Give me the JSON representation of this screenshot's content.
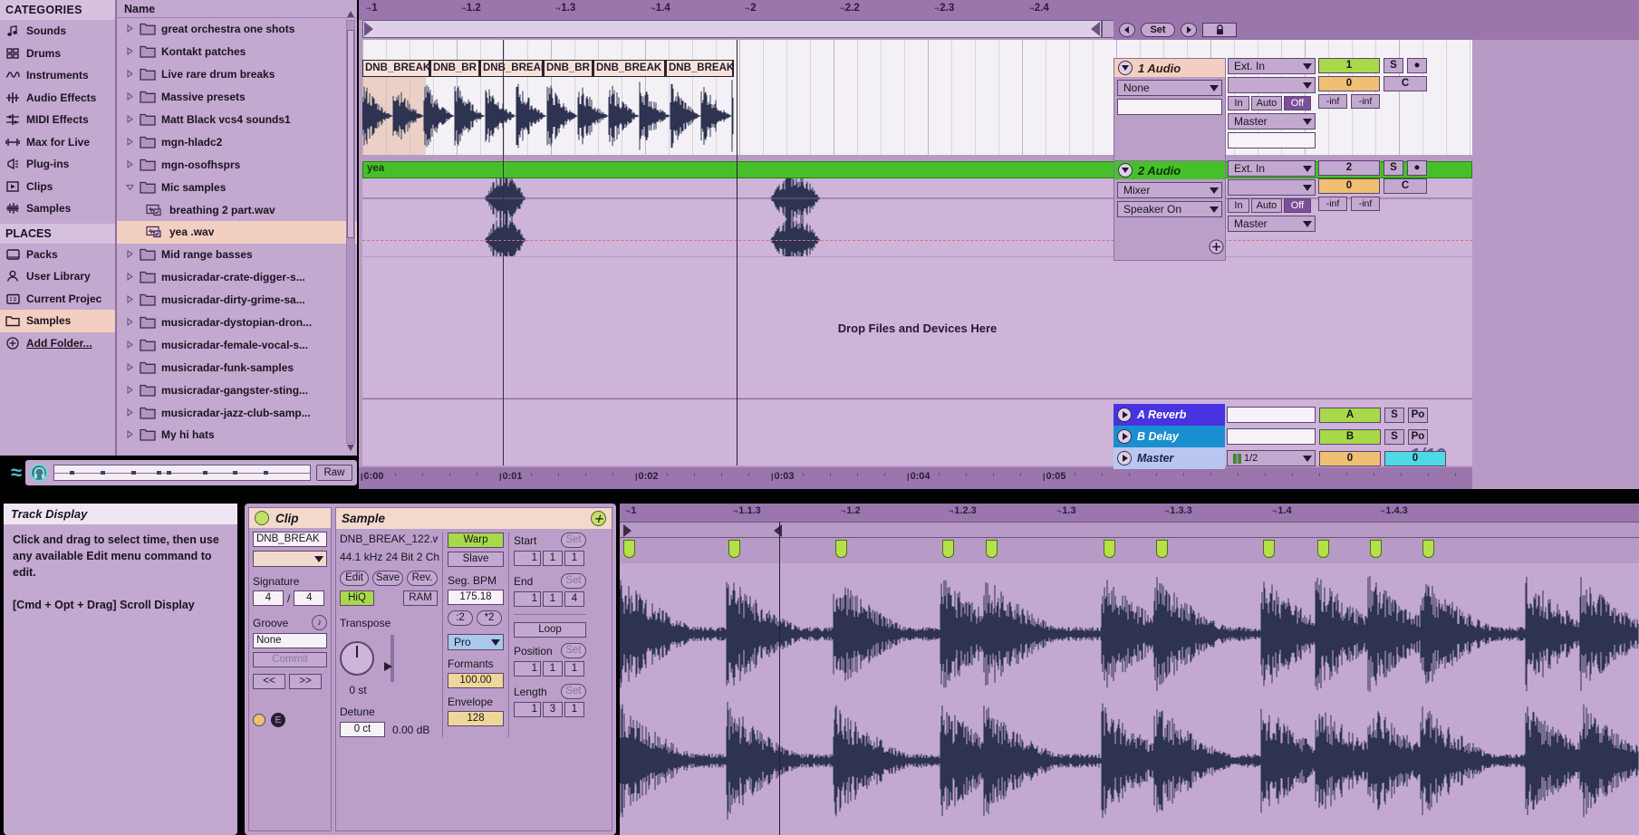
{
  "browser": {
    "categories_header": "CATEGORIES",
    "categories": [
      {
        "label": "Sounds",
        "icon": "note-icon",
        "selected": false
      },
      {
        "label": "Drums",
        "icon": "drums-grid-icon",
        "selected": false
      },
      {
        "label": "Instruments",
        "icon": "waveform-icon",
        "selected": false
      },
      {
        "label": "Audio Effects",
        "icon": "audio-effects-icon",
        "selected": false
      },
      {
        "label": "MIDI Effects",
        "icon": "midi-effects-icon",
        "selected": false
      },
      {
        "label": "Max for Live",
        "icon": "max-for-live-icon",
        "selected": false
      },
      {
        "label": "Plug-ins",
        "icon": "plugin-icon",
        "selected": false
      },
      {
        "label": "Clips",
        "icon": "clip-icon",
        "selected": false
      },
      {
        "label": "Samples",
        "icon": "samples-icon",
        "selected": false
      }
    ],
    "places_header": "PLACES",
    "places": [
      {
        "label": "Packs",
        "icon": "pack-icon",
        "selected": false
      },
      {
        "label": "User Library",
        "icon": "user-icon",
        "selected": false
      },
      {
        "label": "Current Projec",
        "icon": "project-icon",
        "selected": false
      },
      {
        "label": "Samples",
        "icon": "folder-icon",
        "selected": true
      },
      {
        "label": "Add Folder...",
        "icon": "plus-circle-icon",
        "selected": false
      }
    ],
    "files_header": "Name",
    "files": [
      {
        "label": "great orchestra one shots",
        "type": "folder",
        "expanded": false,
        "selected": false
      },
      {
        "label": "Kontakt patches",
        "type": "folder",
        "expanded": false,
        "selected": false
      },
      {
        "label": "Live rare drum breaks",
        "type": "folder",
        "expanded": false,
        "selected": false
      },
      {
        "label": "Massive presets",
        "type": "folder",
        "expanded": false,
        "selected": false
      },
      {
        "label": "Matt Black vcs4 sounds1",
        "type": "folder",
        "expanded": false,
        "selected": false
      },
      {
        "label": "mgn-hladc2",
        "type": "folder",
        "expanded": false,
        "selected": false
      },
      {
        "label": "mgn-osofhsprs",
        "type": "folder",
        "expanded": false,
        "selected": false
      },
      {
        "label": "Mic samples",
        "type": "folder",
        "expanded": true,
        "selected": false
      },
      {
        "label": "breathing 2 part.wav",
        "type": "wav",
        "child": true,
        "selected": false
      },
      {
        "label": "yea .wav",
        "type": "wav",
        "child": true,
        "selected": true
      },
      {
        "label": "Mid range basses",
        "type": "folder",
        "expanded": false,
        "selected": false
      },
      {
        "label": "musicradar-crate-digger-s...",
        "type": "folder",
        "expanded": false,
        "selected": false
      },
      {
        "label": "musicradar-dirty-grime-sa...",
        "type": "folder",
        "expanded": false,
        "selected": false
      },
      {
        "label": "musicradar-dystopian-dron...",
        "type": "folder",
        "expanded": false,
        "selected": false
      },
      {
        "label": "musicradar-female-vocal-s...",
        "type": "folder",
        "expanded": false,
        "selected": false
      },
      {
        "label": "musicradar-funk-samples",
        "type": "folder",
        "expanded": false,
        "selected": false
      },
      {
        "label": "musicradar-gangster-sting...",
        "type": "folder",
        "expanded": false,
        "selected": false
      },
      {
        "label": "musicradar-jazz-club-samp...",
        "type": "folder",
        "expanded": false,
        "selected": false
      },
      {
        "label": "My hi hats",
        "type": "folder",
        "expanded": false,
        "selected": false
      }
    ],
    "overview": {
      "raw_label": "Raw"
    }
  },
  "arrangement": {
    "ruler_ticks": [
      "1",
      "1.2",
      "1.3",
      "1.4",
      "2",
      "2.2",
      "2.3",
      "2.4"
    ],
    "set_controls": {
      "set_label": "Set",
      "lock_icon": "lock-icon",
      "left_icon": "arrow-left-icon",
      "right_icon": "arrow-right-icon"
    },
    "clips": [
      "DNB_BREAK",
      "DNB_BR",
      "DNB_BREAK",
      "DNB_BR",
      "DNB_BREAK",
      "DNB_BREAK"
    ],
    "track2_clip_name": "yea",
    "drop_hint": "Drop Files and Devices Here",
    "quantization": "1/16",
    "time_ticks": [
      "0:00",
      "0:01",
      "0:02",
      "0:03",
      "0:04",
      "0:05"
    ]
  },
  "tracks": [
    {
      "name": "1 Audio",
      "device_slot": "None",
      "input_type": "Ext. In",
      "input_channel": "",
      "monitor": {
        "in": "In",
        "auto": "Auto",
        "off": "Off",
        "active": "Off"
      },
      "output": "Master",
      "output_sub": "",
      "number": "1",
      "solo": "S",
      "arm": "●",
      "volume": "0",
      "pan": "C",
      "meter_left": "-inf",
      "meter_right": "-inf"
    },
    {
      "name": "2 Audio",
      "device_slot": "Mixer",
      "device_slot2": "Speaker On",
      "input_type": "Ext. In",
      "input_channel": "",
      "monitor": {
        "in": "In",
        "auto": "Auto",
        "off": "Off",
        "active": "Off"
      },
      "output": "Master",
      "number": "2",
      "solo": "S",
      "arm": "●",
      "volume": "0",
      "pan": "C",
      "meter_left": "-inf",
      "meter_right": "-inf"
    }
  ],
  "returns": [
    {
      "name": "A Reverb",
      "letter": "A",
      "solo": "S",
      "extra": "Po"
    },
    {
      "name": "B Delay",
      "letter": "B",
      "solo": "S",
      "extra": "Po"
    }
  ],
  "master": {
    "name": "Master",
    "crossfade": "1/2",
    "volume": "0",
    "pan": "0"
  },
  "help_panel": {
    "title": "Track Display",
    "body1": "Click and drag to select time, then use any available Edit menu command to edit.",
    "body2": "[Cmd + Opt + Drag] Scroll Display"
  },
  "clip_panel": {
    "clip_header": "Clip",
    "clip_name": "DNB_BREAK",
    "color_swatch": "",
    "signature_label": "Signature",
    "signature_num": "4",
    "signature_den": "4",
    "groove_label": "Groove",
    "groove_value": "None",
    "commit_label": "Commit",
    "nudge_back": "<<",
    "nudge_fwd": ">>",
    "sample_header": "Sample",
    "sample_name": "DNB_BREAK_122.w",
    "sample_format": "44.1 kHz 24 Bit 2 Ch",
    "edit_label": "Edit",
    "save_label": "Save",
    "rev_label": "Rev.",
    "hiq_label": "HiQ",
    "ram_label": "RAM",
    "transpose_label": "Transpose",
    "transpose_value": "0 st",
    "detune_label": "Detune",
    "detune_value": "0 ct",
    "gain_value": "0.00 dB",
    "warp_label": "Warp",
    "warp_mode_sync": "Slave",
    "seg_bpm_label": "Seg. BPM",
    "seg_bpm_value": "175.18",
    "div2_label": ":2",
    "mul2_label": "*2",
    "warp_algo": "Pro",
    "formants_label": "Formants",
    "formants_value": "100.00",
    "envelope_label": "Envelope",
    "envelope_value": "128",
    "start_label": "Start",
    "start_set": "Set",
    "start_bars": "1",
    "start_beats": "1",
    "start_sixteenths": "1",
    "end_label": "End",
    "end_set": "Set",
    "end_bars": "1",
    "end_beats": "1",
    "end_sixteenths": "4",
    "loop_label": "Loop",
    "position_label": "Position",
    "position_set": "Set",
    "position_bars": "1",
    "position_beats": "1",
    "position_sixteenths": "1",
    "length_label": "Length",
    "length_set": "Set",
    "length_bars": "1",
    "length_beats": "3",
    "length_sixteenths": "1"
  },
  "clip_editor": {
    "ticks": [
      "1",
      "1.1.3",
      "1.2",
      "1.2.3",
      "1.3",
      "1.3.3",
      "1.4",
      "1.4.3"
    ]
  },
  "colors": {
    "track1": "#f2cfc0",
    "track2": "#46c02a",
    "reverb": "#4733e0",
    "delay": "#1a8fd0",
    "master": "#b8c6f0",
    "accent_green": "#a8d94a",
    "accent_orange": "#efbf72",
    "accent_cyan": "#4ed9e4"
  }
}
